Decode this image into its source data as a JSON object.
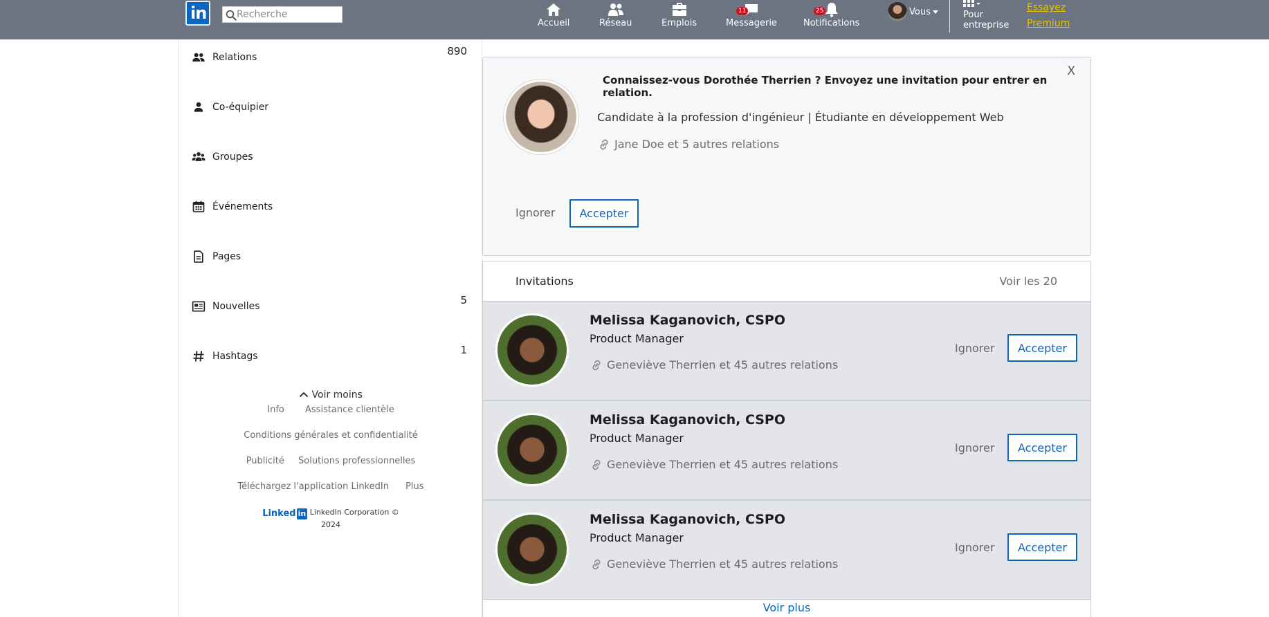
{
  "nav": {
    "logo_text": "in",
    "search_placeholder": "Recherche",
    "items": [
      {
        "label": "Accueil",
        "icon": "home-icon"
      },
      {
        "label": "Réseau",
        "icon": "network-icon"
      },
      {
        "label": "Emplois",
        "icon": "briefcase-icon"
      },
      {
        "label": "Messagerie",
        "icon": "message-icon",
        "badge": "11"
      },
      {
        "label": "Notifications",
        "icon": "bell-icon",
        "badge": "25"
      }
    ],
    "me_label": "Vous",
    "business_line1": "Pour",
    "business_line2": "entreprise",
    "premium_line1": "Essayez",
    "premium_line2": "Premium",
    "premium_color": "#e7c400"
  },
  "sidebar": {
    "items": [
      {
        "label": "Relations",
        "icon": "people-icon",
        "count": "890"
      },
      {
        "label": "Co-équipier",
        "icon": "person-icon",
        "count": ""
      },
      {
        "label": "Groupes",
        "icon": "group-icon",
        "count": ""
      },
      {
        "label": "Événements",
        "icon": "calendar-icon",
        "count": ""
      },
      {
        "label": "Pages",
        "icon": "page-icon",
        "count": ""
      },
      {
        "label": "Nouvelles",
        "icon": "newspaper-icon",
        "count": "5"
      },
      {
        "label": "Hashtags",
        "icon": "hashtag-icon",
        "count": "1"
      }
    ],
    "see_less": "Voir moins",
    "footer": {
      "info": "Info",
      "support": "Assistance clientèle",
      "terms": "Conditions générales et confidentialité",
      "ads": "Publicité",
      "business_solutions": "Solutions professionnelles",
      "download_app": "Téléchargez l'application LinkedIn",
      "more": "Plus",
      "logo_word": "Linked",
      "logo_box": "in",
      "copyright_line1": "LinkedIn Corporation ©",
      "copyright_line2": "2024"
    }
  },
  "suggestion": {
    "headline": "Connaissez-vous Dorothée Therrien ? Envoyez une invitation pour entrer en relation.",
    "description": "Candidate à la profession d'ingénieur | Étudiante en développement Web",
    "mutual": "Jane Doe et 5 autres relations",
    "close": "X",
    "ignore": "Ignorer",
    "accept": "Accepter"
  },
  "invitations": {
    "title": "Invitations",
    "see_all": "Voir les 20",
    "items": [
      {
        "name": "Melissa Kaganovich, CSPO",
        "job": "Product Manager",
        "mutual": "Geneviève Therrien et 45 autres relations",
        "ignore": "Ignorer",
        "accept": "Accepter"
      },
      {
        "name": "Melissa Kaganovich, CSPO",
        "job": "Product Manager",
        "mutual": "Geneviève Therrien et 45 autres relations",
        "ignore": "Ignorer",
        "accept": "Accepter"
      },
      {
        "name": "Melissa Kaganovich, CSPO",
        "job": "Product Manager",
        "mutual": "Geneviève Therrien et 45 autres relations",
        "ignore": "Ignorer",
        "accept": "Accepter"
      }
    ],
    "see_more": "Voir plus"
  },
  "colors": {
    "topbar": "#6b7480",
    "accent": "#0a66c2",
    "badge": "#d11124",
    "row_background": "#e3e5e8"
  }
}
